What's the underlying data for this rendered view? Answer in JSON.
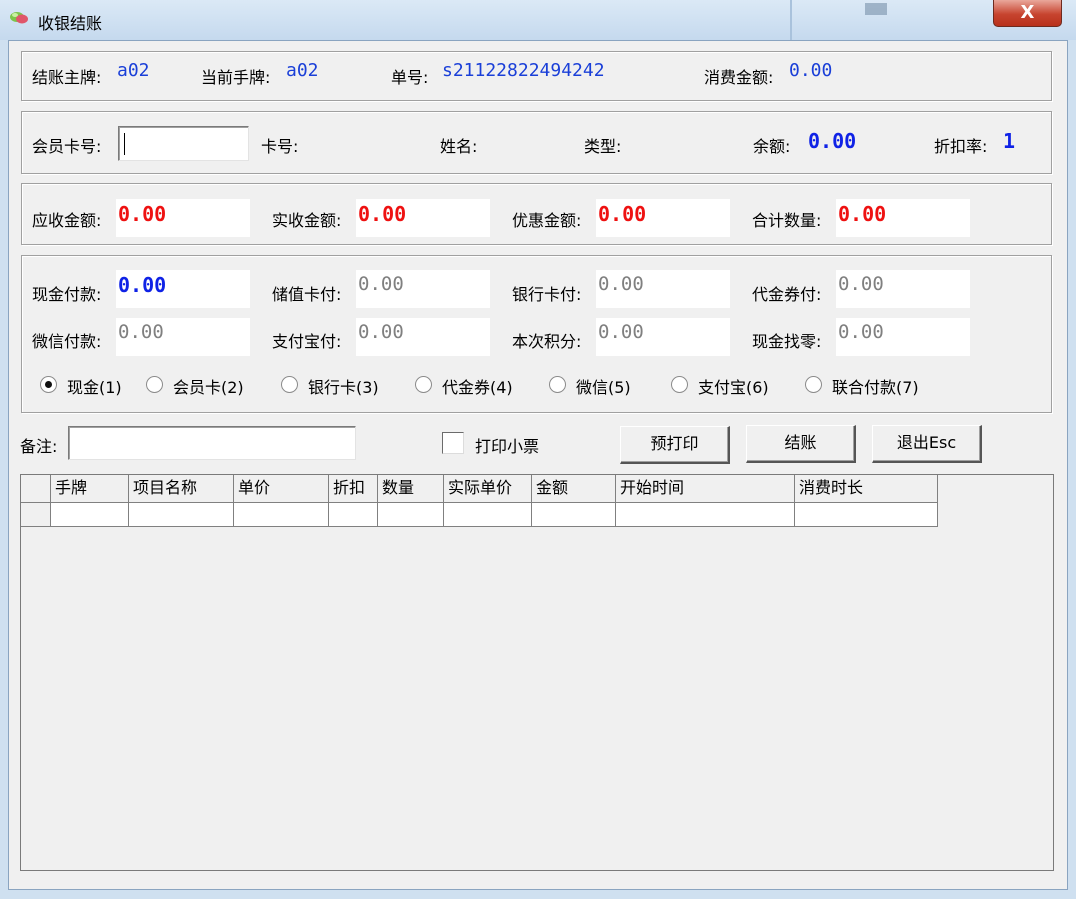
{
  "window": {
    "title": "收银结账",
    "close_label": "X"
  },
  "info": {
    "checkout_tag_label": "结账主牌:",
    "checkout_tag": "a02",
    "current_tag_label": "当前手牌:",
    "current_tag": "a02",
    "order_no_label": "单号:",
    "order_no": "s21122822494242",
    "consume_label": "消费金额:",
    "consume_amount": "0.00"
  },
  "member": {
    "card_input_label": "会员卡号:",
    "card_input_value": "",
    "card_no_label": "卡号:",
    "name_label": "姓名:",
    "type_label": "类型:",
    "balance_label": "余额:",
    "balance": "0.00",
    "discount_label": "折扣率:",
    "discount": "1"
  },
  "amounts": {
    "receivable_label": "应收金额:",
    "receivable": "0.00",
    "received_label": "实收金额:",
    "received": "0.00",
    "discount_amount_label": "优惠金额:",
    "discount_amount": "0.00",
    "total_qty_label": "合计数量:",
    "total_qty": "0.00"
  },
  "payments": {
    "cash_label": "现金付款:",
    "cash": "0.00",
    "stored_card_label": "储值卡付:",
    "stored_card": "0.00",
    "bank_card_label": "银行卡付:",
    "bank_card": "0.00",
    "voucher_label": "代金券付:",
    "voucher": "0.00",
    "wechat_label": "微信付款:",
    "wechat": "0.00",
    "alipay_label": "支付宝付:",
    "alipay": "0.00",
    "points_label": "本次积分:",
    "points": "0.00",
    "change_label": "现金找零:",
    "change": "0.00"
  },
  "methods": [
    {
      "label": "现金(1)",
      "selected": true
    },
    {
      "label": "会员卡(2)",
      "selected": false
    },
    {
      "label": "银行卡(3)",
      "selected": false
    },
    {
      "label": "代金券(4)",
      "selected": false
    },
    {
      "label": "微信(5)",
      "selected": false
    },
    {
      "label": "支付宝(6)",
      "selected": false
    },
    {
      "label": "联合付款(7)",
      "selected": false
    }
  ],
  "actions": {
    "remark_label": "备注:",
    "remark_value": "",
    "print_receipt_label": "打印小票",
    "print_receipt_checked": false,
    "preprint_label": "预打印",
    "checkout_label": "结账",
    "exit_label": "退出Esc"
  },
  "table": {
    "columns": [
      "手牌",
      "项目名称",
      "单价",
      "折扣",
      "数量",
      "实际单价",
      "金额",
      "开始时间",
      "消费时长"
    ],
    "rows": [
      [
        "",
        "",
        "",
        "",
        "",
        "",
        "",
        "",
        ""
      ]
    ]
  }
}
